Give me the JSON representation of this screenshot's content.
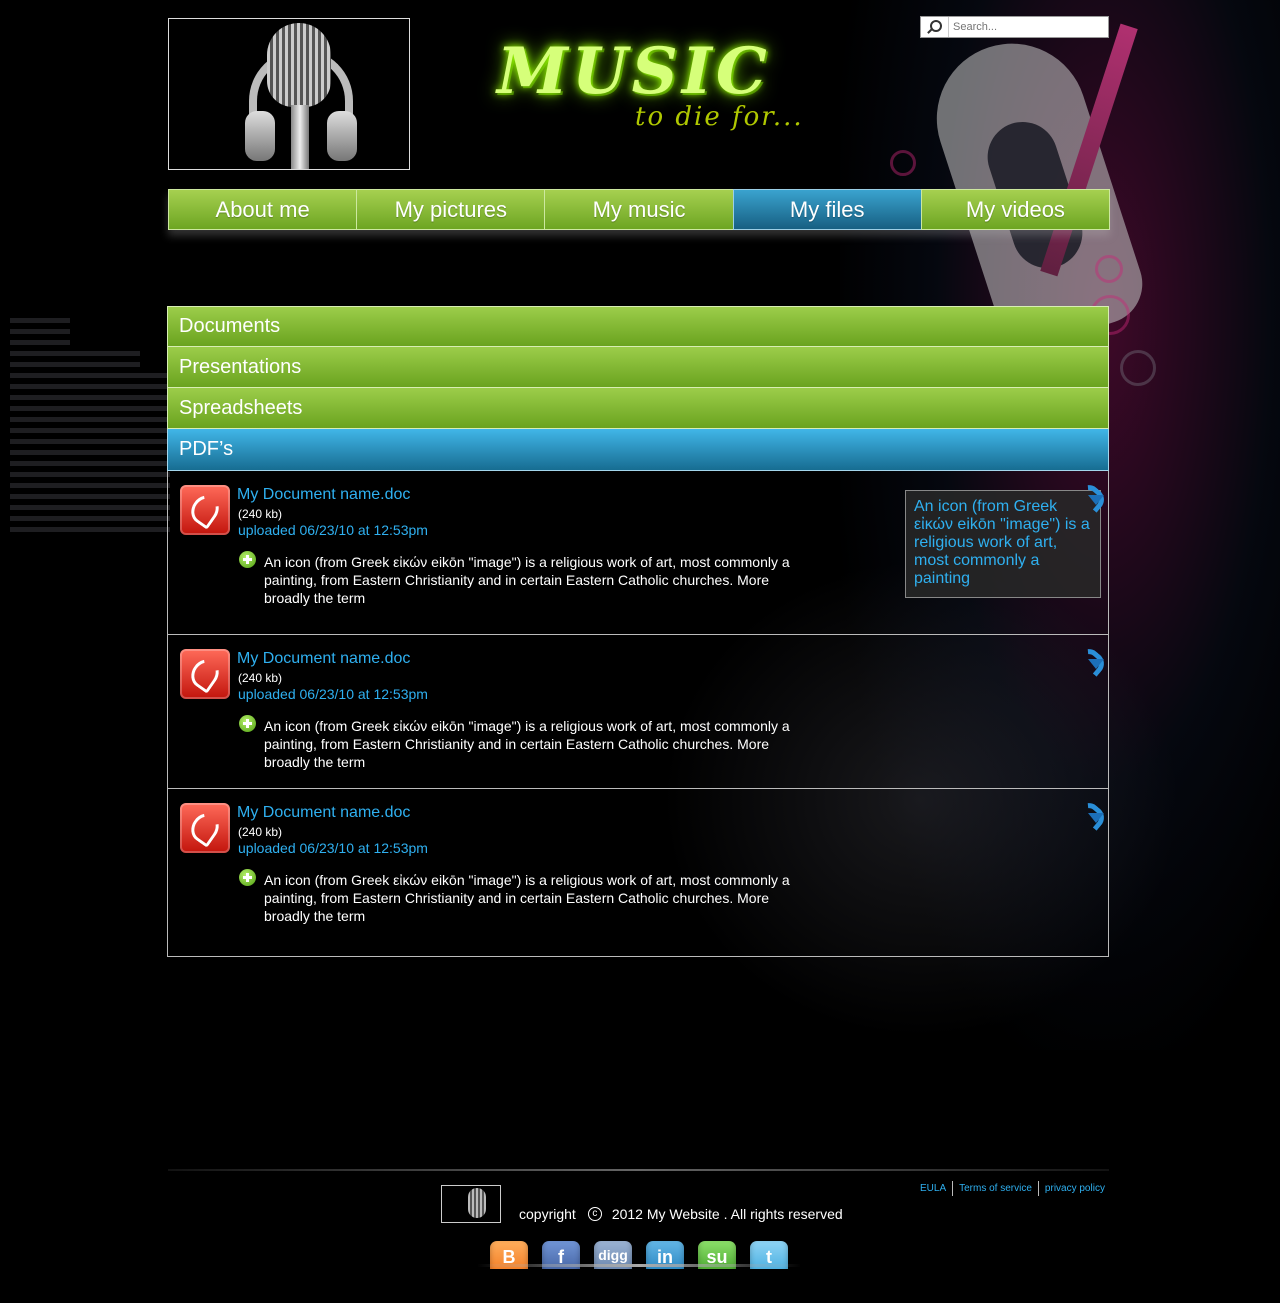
{
  "search": {
    "placeholder": "Search..."
  },
  "brand": {
    "title": "MUSIC",
    "tagline": "to die for..."
  },
  "nav": [
    {
      "label": "About me",
      "active": false
    },
    {
      "label": "My pictures",
      "active": false
    },
    {
      "label": "My music",
      "active": false
    },
    {
      "label": "My files",
      "active": true
    },
    {
      "label": "My videos",
      "active": false
    }
  ],
  "categories": [
    {
      "label": "Documents",
      "active": false
    },
    {
      "label": "Presentations",
      "active": false
    },
    {
      "label": "Spreadsheets",
      "active": false
    },
    {
      "label": "PDF’s",
      "active": true
    }
  ],
  "files": [
    {
      "name": "My Document name.doc",
      "size": "(240 kb)",
      "uploaded": "uploaded 06/23/10 at 12:53pm",
      "description": "An icon (from Greek εἰκών eikōn \"image\") is a religious work of art, most commonly a painting, from Eastern Christianity and in certain Eastern Catholic churches. More broadly the term"
    },
    {
      "name": "My Document name.doc",
      "size": "(240 kb)",
      "uploaded": "uploaded 06/23/10 at 12:53pm",
      "description": "An icon (from Greek εἰκών eikōn \"image\") is a religious work of art, most commonly a painting, from Eastern Christianity and in certain Eastern Catholic churches. More broadly the term"
    },
    {
      "name": "My Document name.doc",
      "size": "(240 kb)",
      "uploaded": "uploaded 06/23/10 at 12:53pm",
      "description": "An icon (from Greek εἰκών eikōn \"image\") is a religious work of art, most commonly a painting, from Eastern Christianity and in certain Eastern Catholic churches. More broadly the term"
    }
  ],
  "tooltip": {
    "text": "An icon (from Greek εἰκών eikōn \"image\") is a religious work of art, most commonly a painting"
  },
  "footer": {
    "copyright_prefix": "copyright",
    "copyright_symbol": "c",
    "copyright_text": "2012 My Website . All rights reserved",
    "links": [
      "EULA",
      "Terms of service",
      "privacy policy"
    ],
    "social": [
      {
        "icon": "blogger-icon",
        "glyph": "B"
      },
      {
        "icon": "facebook-icon",
        "glyph": "f"
      },
      {
        "icon": "digg-icon",
        "glyph": "digg"
      },
      {
        "icon": "linkedin-icon",
        "glyph": "in"
      },
      {
        "icon": "stumbleupon-icon",
        "glyph": "su"
      },
      {
        "icon": "twitter-icon",
        "glyph": "t"
      }
    ]
  },
  "colors": {
    "nav_green": "#8bbf3a",
    "active_blue": "#2a8fbf",
    "link_blue": "#2fb0f0",
    "background": "#000000"
  }
}
